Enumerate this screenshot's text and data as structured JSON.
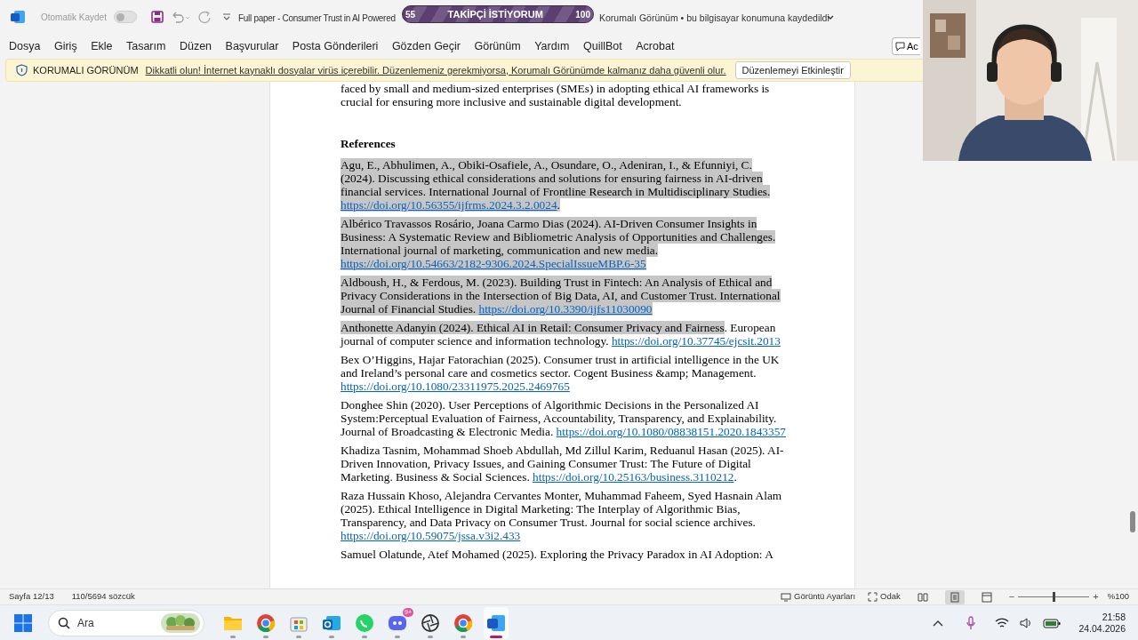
{
  "title_bar": {
    "autosave_label": "Otomatik Kaydet",
    "autosave_on": false,
    "document_title": "Full paper - Consumer Trust in AI Powered",
    "location": "Korumalı Görünüm • bu bilgisayar konumuna kaydedildi"
  },
  "goal_overlay": {
    "start": "55",
    "label": "TAKİPÇİ İSTİYORUM",
    "end": "100"
  },
  "menu": [
    "Dosya",
    "Giriş",
    "Ekle",
    "Tasarım",
    "Düzen",
    "Başvurular",
    "Posta Gönderileri",
    "Gözden Geçir",
    "Görünüm",
    "Yardım",
    "QuillBot",
    "Acrobat"
  ],
  "comment_button": "Ac",
  "protected_view": {
    "title": "KORUMALI GÖRÜNÜM",
    "message": "Dikkatli olun! İnternet kaynaklı dosyalar virüs içerebilir. Düzenlemeniz gerekmiyorsa, Korumalı Görünümde kalmanız daha güvenli olur.",
    "button": "Düzenlemeyi Etkinleştir"
  },
  "document": {
    "paragraph": "faced by small and medium-sized enterprises (SMEs) in adopting ethical AI frameworks is crucial for ensuring more inclusive and sustainable digital development.",
    "heading": "References",
    "references": [
      {
        "segments": [
          {
            "kind": "text",
            "selected": true,
            "text": "Agu, E., Abhulimen, A., Obiki-Osafiele, A., Osundare, O., Adeniran, I., & Efunniyi, C. (2024). Discussing ethical considerations and solutions for ensuring fairness in AI-driven financial services. International Journal of Frontline Research in Multidisciplinary Studies. "
          },
          {
            "kind": "link",
            "selected": true,
            "text": "https://doi.org/10.56355/ijfrms.2024.3.2.0024"
          },
          {
            "kind": "text",
            "selected": true,
            "text": "."
          }
        ]
      },
      {
        "segments": [
          {
            "kind": "text",
            "selected": true,
            "text": "Albérico Travassos Rosário, Joana Carmo Dias (2024). AI-Driven Consumer Insights in Business: A Systematic Review and Bibliometric Analysis of Opportunities and Challenges. International journal of marketing, communication and new media. "
          },
          {
            "kind": "link",
            "selected": true,
            "text": "https://doi.org/10.54663/2182-9306.2024.SpecialIssueMBP.6-35"
          }
        ]
      },
      {
        "segments": [
          {
            "kind": "text",
            "selected": true,
            "text": "Aldboush, H., & Ferdous, M. (2023). Building Trust in Fintech: An Analysis of Ethical and Privacy Considerations in the Intersection of Big Data, AI, and Customer Trust. International Journal of Financial Studies. "
          },
          {
            "kind": "link",
            "selected": true,
            "text": "https://doi.org/10.3390/ijfs11030090"
          }
        ]
      },
      {
        "segments": [
          {
            "kind": "text",
            "selected": true,
            "text": "Anthonette Adanyin (2024). Ethical AI in Retail: Consumer Privacy and Fairness"
          },
          {
            "kind": "text",
            "selected": false,
            "text": ". European journal of computer science and information technology. "
          },
          {
            "kind": "link",
            "selected": false,
            "text": "https://doi.org/10.37745/ejcsit.2013"
          }
        ]
      },
      {
        "segments": [
          {
            "kind": "text",
            "selected": false,
            "text": "Bex O’Higgins, Hajar Fatorachian (2025). Consumer trust in artificial intelligence in the UK and Ireland’s personal care and cosmetics sector. Cogent Business &amp; Management. "
          },
          {
            "kind": "link",
            "selected": false,
            "text": "https://doi.org/10.1080/23311975.2025.2469765"
          }
        ]
      },
      {
        "segments": [
          {
            "kind": "text",
            "selected": false,
            "text": "Donghee Shin (2020). User Perceptions of Algorithmic Decisions in the Personalized AI System:Perceptual Evaluation of Fairness, Accountability, Transparency, and Explainability. Journal of Broadcasting & Electronic Media. "
          },
          {
            "kind": "link",
            "selected": false,
            "text": "https://doi.org/10.1080/08838151.2020.1843357"
          }
        ]
      },
      {
        "segments": [
          {
            "kind": "text",
            "selected": false,
            "text": "Khadiza Tasnim, Mohammad Shoeb Abdullah, Md Zillul Karim, Reduanul Hasan (2025). AI-Driven Innovation, Privacy Issues, and Gaining Consumer Trust: The Future of Digital Marketing. Business & Social Sciences. "
          },
          {
            "kind": "link",
            "selected": false,
            "text": "https://doi.org/10.25163/business.3110212"
          },
          {
            "kind": "text",
            "selected": false,
            "text": "."
          }
        ]
      },
      {
        "segments": [
          {
            "kind": "text",
            "selected": false,
            "text": "Raza Hussain Khoso, Alejandra Cervantes Monter, Muhammad Faheem, Syed Hasnain Alam (2025). Ethical Intelligence in Digital Marketing: The Interplay of Algorithmic Bias, Transparency, and Data Privacy on Consumer Trust. Journal for social science archives. "
          },
          {
            "kind": "link",
            "selected": false,
            "text": "https://doi.org/10.59075/jssa.v3i2.433"
          }
        ]
      },
      {
        "segments": [
          {
            "kind": "text",
            "selected": false,
            "text": "Samuel Olatunde, Atef Mohamed (2025). Exploring the Privacy Paradox in AI Adoption: A"
          }
        ]
      }
    ]
  },
  "status_bar": {
    "page": "Sayfa 12/13",
    "words": "110/5694 sözcük",
    "display_settings": "Görüntü Ayarları",
    "focus": "Odak",
    "views": [
      {
        "kind": "read",
        "selected": false
      },
      {
        "kind": "print",
        "selected": true
      },
      {
        "kind": "web",
        "selected": false
      }
    ],
    "zoom": {
      "level": 0.5,
      "label": "%100",
      "zoom_out": "−",
      "zoom_in": "+"
    }
  },
  "taskbar": {
    "search": {
      "placeholder": "Ara"
    },
    "apps": [
      {
        "kind": "folder",
        "active": false
      },
      {
        "kind": "browser",
        "active": false
      },
      {
        "kind": "store",
        "active": false
      },
      {
        "kind": "mail",
        "active": false
      },
      {
        "kind": "chat",
        "active": false
      },
      {
        "kind": "discord",
        "active": false,
        "badge": "9+"
      },
      {
        "kind": "aperture",
        "active": false
      },
      {
        "kind": "browser",
        "active": false
      },
      {
        "kind": "word",
        "active": true
      }
    ],
    "time": "21:58",
    "date": "24.04.2026"
  }
}
